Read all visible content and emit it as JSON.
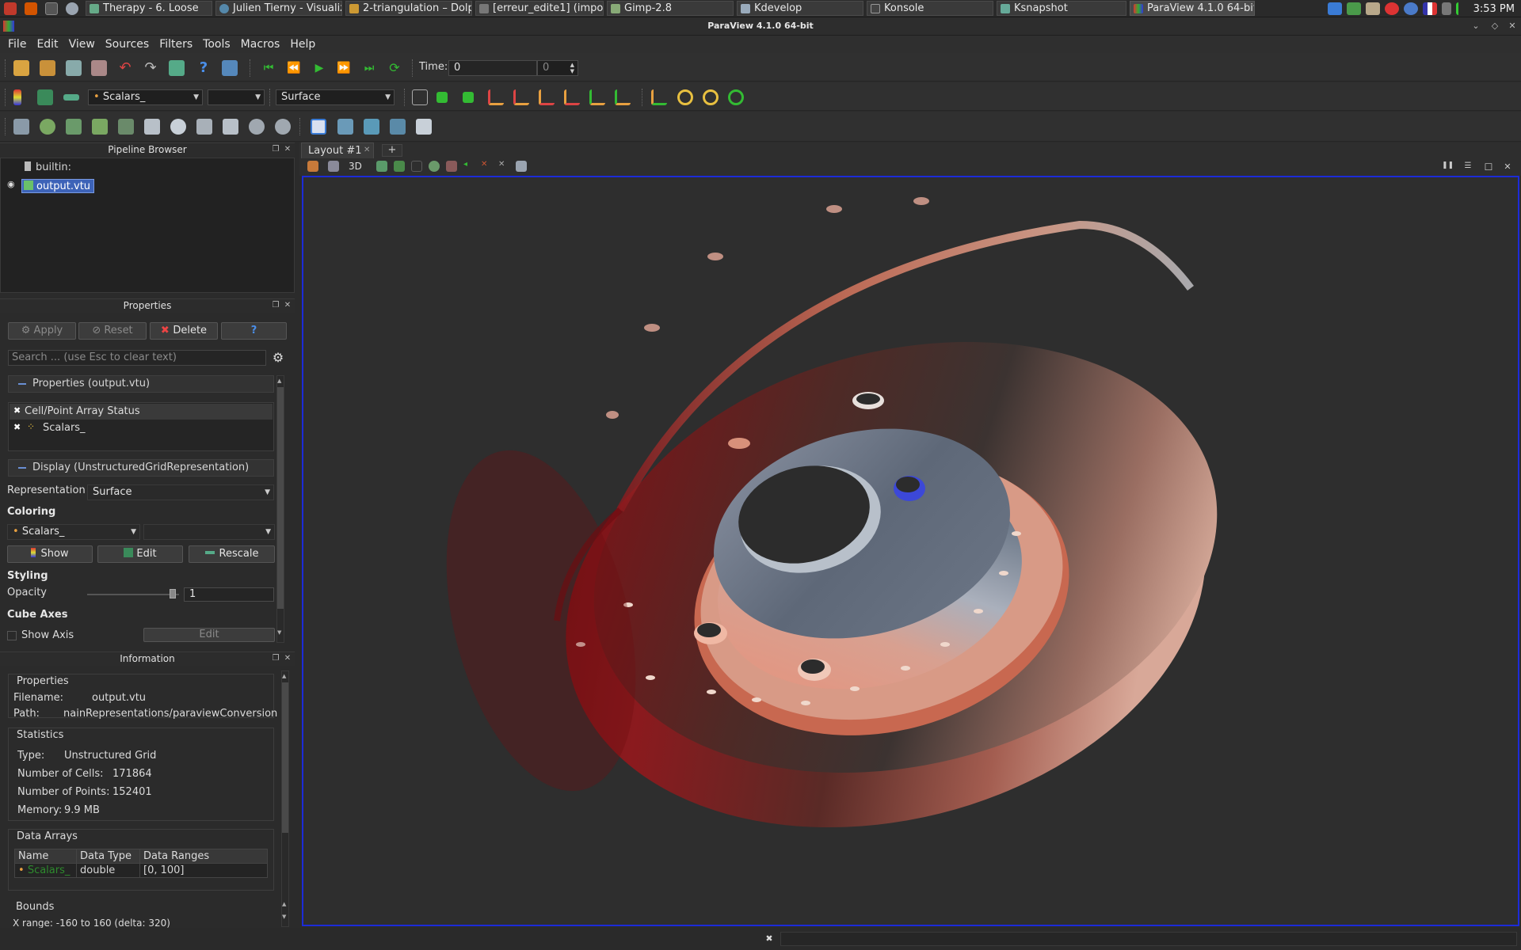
{
  "taskbar": {
    "tasks": [
      "Therapy - 6. Loose",
      "Julien Tierny - Visualiz",
      "2-triangulation – Dolp",
      "[erreur_edite1] (impo",
      "Gimp-2.8",
      "Kdevelop",
      "Konsole",
      "Ksnapshot",
      "ParaView 4.1.0 64-bit"
    ],
    "clock": "3:53 PM"
  },
  "window": {
    "title": "ParaView 4.1.0 64-bit"
  },
  "menu": [
    "File",
    "Edit",
    "View",
    "Sources",
    "Filters",
    "Tools",
    "Macros",
    "Help"
  ],
  "toolbar": {
    "time_label": "Time:",
    "time_value": "0",
    "time_step": "0",
    "scalars_combo": "Scalars_",
    "component_combo": "",
    "representation_combo": "Surface"
  },
  "pipeline": {
    "title": "Pipeline Browser",
    "root": "builtin:",
    "item": "output.vtu"
  },
  "properties": {
    "title": "Properties",
    "apply": "Apply",
    "reset": "Reset",
    "delete": "Delete",
    "help": "?",
    "search_placeholder": "Search ... (use Esc to clear text)",
    "section_props": "Properties (output.vtu)",
    "array_status_header": "Cell/Point Array Status",
    "array_item": "Scalars_",
    "section_display": "Display (UnstructuredGridRepresentation)",
    "representation_label": "Representation",
    "representation_value": "Surface",
    "coloring_label": "Coloring",
    "coloring_value": "Scalars_",
    "coloring_component": "",
    "show": "Show",
    "edit": "Edit",
    "rescale": "Rescale",
    "styling_label": "Styling",
    "opacity_label": "Opacity",
    "opacity_value": "1",
    "cube_axes_label": "Cube Axes",
    "show_axis": "Show Axis",
    "axis_edit": "Edit"
  },
  "information": {
    "title": "Information",
    "props_group": "Properties",
    "filename_label": "Filename:",
    "filename": "output.vtu",
    "path_label": "Path:",
    "path": "nainRepresentations/paraviewConversion",
    "stats_group": "Statistics",
    "type_label": "Type:",
    "type": "Unstructured Grid",
    "cells_label": "Number of Cells:",
    "cells": "171864",
    "points_label": "Number of Points:",
    "points": "152401",
    "memory_label": "Memory:",
    "memory": "9.9 MB",
    "arrays_group": "Data Arrays",
    "col_name": "Name",
    "col_type": "Data Type",
    "col_ranges": "Data Ranges",
    "row_name": "Scalars_",
    "row_type": "double",
    "row_range": "[0, 100]",
    "bounds_group": "Bounds",
    "xrange": "X range:  -160 to 160 (delta: 320)"
  },
  "layout": {
    "tab": "Layout #1",
    "add_tab": "+",
    "mode": "3D"
  },
  "colors": {
    "selection_blue": "#1c2bd8",
    "disc_red": "#8b1a1e",
    "disc_salmon": "#e8917a",
    "hub_gray": "#7b8796"
  }
}
